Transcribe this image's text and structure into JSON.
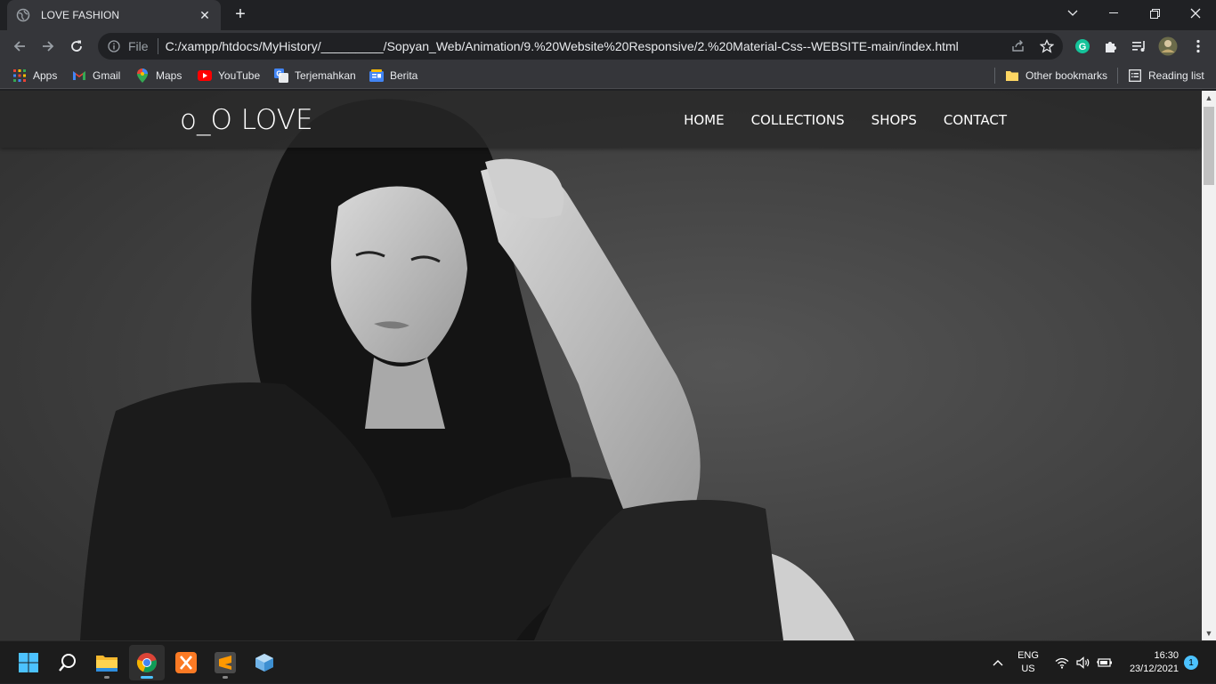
{
  "browser": {
    "tab_title": "LOVE FASHION",
    "address_scheme": "File",
    "url": "C:/xampp/htdocs/MyHistory/_________/Sopyan_Web/Animation/9.%20Website%20Responsive/2.%20Material-Css--WEBSITE-main/index.html"
  },
  "bookmarks": [
    {
      "label": "Apps",
      "icon": "apps-grid-icon"
    },
    {
      "label": "Gmail",
      "icon": "gmail-icon"
    },
    {
      "label": "Maps",
      "icon": "maps-icon"
    },
    {
      "label": "YouTube",
      "icon": "youtube-icon"
    },
    {
      "label": "Terjemahkan",
      "icon": "translate-icon"
    },
    {
      "label": "Berita",
      "icon": "news-icon"
    }
  ],
  "bookmarks_right": {
    "other": "Other bookmarks",
    "reading_list": "Reading list"
  },
  "site": {
    "brand": "o_O LOVE",
    "nav": [
      "HOME",
      "COLLECTIONS",
      "SHOPS",
      "CONTACT"
    ]
  },
  "taskbar": {
    "lang_line1": "ENG",
    "lang_line2": "US",
    "time": "16:30",
    "date": "23/12/2021",
    "notifications": "1"
  },
  "colors": {
    "tab_bg": "#35363a",
    "frame_bg": "#202124",
    "accent": "#4cc2ff"
  }
}
